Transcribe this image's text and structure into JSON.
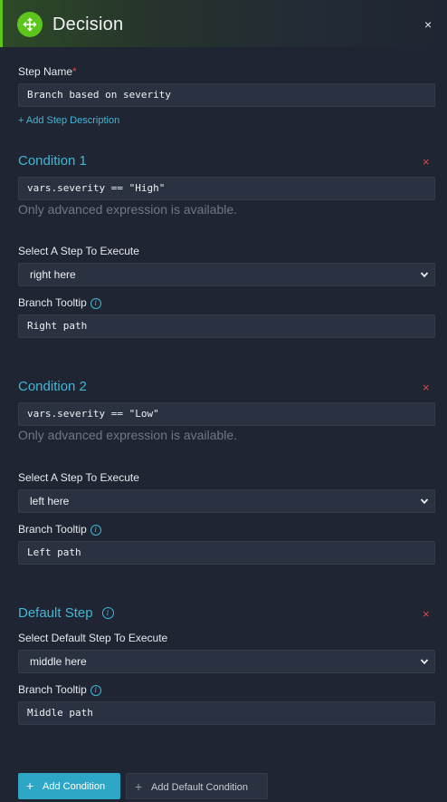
{
  "header": {
    "title": "Decision",
    "close": "×"
  },
  "step": {
    "name_label": "Step Name",
    "required_mark": "*",
    "name_value": "Branch based on severity",
    "add_description": "+ Add Step Description"
  },
  "conditions": [
    {
      "title": "Condition 1",
      "remove": "×",
      "expression": "vars.severity == \"High\"",
      "hint": "Only advanced expression is available.",
      "select_label": "Select A Step To Execute",
      "select_value": "right here",
      "tooltip_label": "Branch Tooltip",
      "tooltip_value": "Right path"
    },
    {
      "title": "Condition 2",
      "remove": "×",
      "expression": "vars.severity == \"Low\"",
      "hint": "Only advanced expression is available.",
      "select_label": "Select A Step To Execute",
      "select_value": "left here",
      "tooltip_label": "Branch Tooltip",
      "tooltip_value": "Left path"
    }
  ],
  "default_step": {
    "title": "Default Step",
    "remove": "×",
    "select_label": "Select Default Step To Execute",
    "select_value": "middle here",
    "tooltip_label": "Branch Tooltip",
    "tooltip_value": "Middle path"
  },
  "info_glyph": "i",
  "buttons": {
    "plus": "+",
    "add_condition": "Add Condition",
    "add_default_condition": "Add Default Condition"
  },
  "colors": {
    "accent_green": "#5ec51c",
    "accent_cyan": "#3fb8d6",
    "danger": "#e04a4a",
    "background": "#1f2532",
    "field": "#2a3140"
  },
  "icons": [
    "decision-icon",
    "close-icon",
    "info-icon",
    "chevron-down-icon",
    "plus-icon"
  ]
}
